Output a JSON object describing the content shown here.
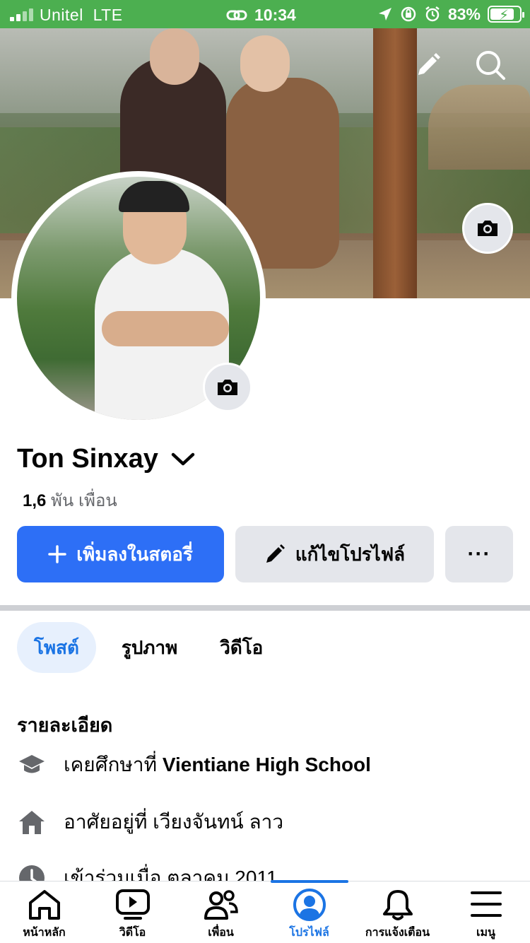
{
  "status_bar": {
    "carrier": "Unitel",
    "network": "LTE",
    "time": "10:34",
    "battery_percent": "83%",
    "battery_level": 0.83,
    "color": "#4caf50"
  },
  "profile": {
    "name": "Ton Sinxay",
    "friends_count": "1,6",
    "friends_unit": "พัน",
    "friends_label": "เพื่อน"
  },
  "actions": {
    "add_story": "เพิ่มลงในสตอรี่",
    "edit_profile": "แก้ไขโปรไฟล์",
    "more": "···"
  },
  "tabs": [
    {
      "label": "โพสต์",
      "active": true
    },
    {
      "label": "รูปภาพ",
      "active": false
    },
    {
      "label": "วิดีโอ",
      "active": false
    }
  ],
  "details": {
    "title": "รายละเอียด",
    "items": [
      {
        "icon": "graduation-cap-icon",
        "prefix": "เคยศึกษาที่ ",
        "bold": "Vientiane High School"
      },
      {
        "icon": "home-icon",
        "prefix": "อาศัยอยู่ที่ เวียงจันทน์ ลาว",
        "bold": ""
      },
      {
        "icon": "clock-icon",
        "prefix": "เข้าร่วมเมื่อ ตุลาคม 2011",
        "bold": ""
      }
    ]
  },
  "bottom_nav": [
    {
      "label": "หน้าหลัก",
      "icon": "home-icon",
      "active": false
    },
    {
      "label": "วิดีโอ",
      "icon": "video-icon",
      "active": false
    },
    {
      "label": "เพื่อน",
      "icon": "friends-icon",
      "active": false
    },
    {
      "label": "โปรไฟล์",
      "icon": "profile-icon",
      "active": true
    },
    {
      "label": "การแจ้งเตือน",
      "icon": "bell-icon",
      "active": false
    },
    {
      "label": "เมนู",
      "icon": "menu-icon",
      "active": false
    }
  ],
  "colors": {
    "accent": "#1b74e4",
    "primary_button": "#2d6ff6",
    "secondary_button": "#e4e6eb"
  }
}
